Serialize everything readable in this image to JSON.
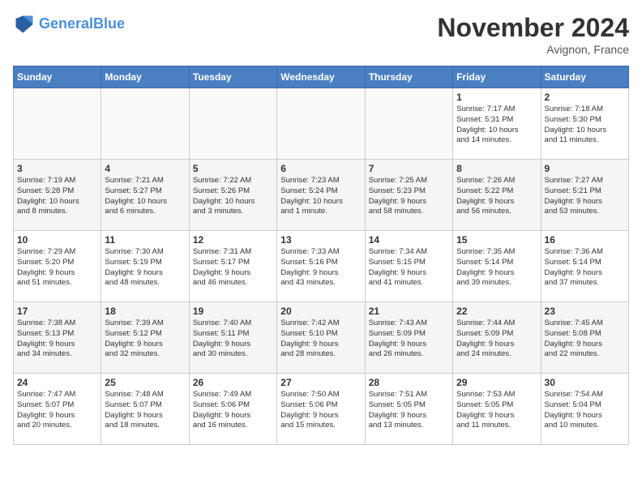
{
  "header": {
    "logo_line1": "General",
    "logo_line2": "Blue",
    "month": "November 2024",
    "location": "Avignon, France"
  },
  "weekdays": [
    "Sunday",
    "Monday",
    "Tuesday",
    "Wednesday",
    "Thursday",
    "Friday",
    "Saturday"
  ],
  "weeks": [
    [
      {
        "day": "",
        "info": ""
      },
      {
        "day": "",
        "info": ""
      },
      {
        "day": "",
        "info": ""
      },
      {
        "day": "",
        "info": ""
      },
      {
        "day": "",
        "info": ""
      },
      {
        "day": "1",
        "info": "Sunrise: 7:17 AM\nSunset: 5:31 PM\nDaylight: 10 hours\nand 14 minutes."
      },
      {
        "day": "2",
        "info": "Sunrise: 7:18 AM\nSunset: 5:30 PM\nDaylight: 10 hours\nand 11 minutes."
      }
    ],
    [
      {
        "day": "3",
        "info": "Sunrise: 7:19 AM\nSunset: 5:28 PM\nDaylight: 10 hours\nand 8 minutes."
      },
      {
        "day": "4",
        "info": "Sunrise: 7:21 AM\nSunset: 5:27 PM\nDaylight: 10 hours\nand 6 minutes."
      },
      {
        "day": "5",
        "info": "Sunrise: 7:22 AM\nSunset: 5:26 PM\nDaylight: 10 hours\nand 3 minutes."
      },
      {
        "day": "6",
        "info": "Sunrise: 7:23 AM\nSunset: 5:24 PM\nDaylight: 10 hours\nand 1 minute."
      },
      {
        "day": "7",
        "info": "Sunrise: 7:25 AM\nSunset: 5:23 PM\nDaylight: 9 hours\nand 58 minutes."
      },
      {
        "day": "8",
        "info": "Sunrise: 7:26 AM\nSunset: 5:22 PM\nDaylight: 9 hours\nand 56 minutes."
      },
      {
        "day": "9",
        "info": "Sunrise: 7:27 AM\nSunset: 5:21 PM\nDaylight: 9 hours\nand 53 minutes."
      }
    ],
    [
      {
        "day": "10",
        "info": "Sunrise: 7:29 AM\nSunset: 5:20 PM\nDaylight: 9 hours\nand 51 minutes."
      },
      {
        "day": "11",
        "info": "Sunrise: 7:30 AM\nSunset: 5:19 PM\nDaylight: 9 hours\nand 48 minutes."
      },
      {
        "day": "12",
        "info": "Sunrise: 7:31 AM\nSunset: 5:17 PM\nDaylight: 9 hours\nand 46 minutes."
      },
      {
        "day": "13",
        "info": "Sunrise: 7:33 AM\nSunset: 5:16 PM\nDaylight: 9 hours\nand 43 minutes."
      },
      {
        "day": "14",
        "info": "Sunrise: 7:34 AM\nSunset: 5:15 PM\nDaylight: 9 hours\nand 41 minutes."
      },
      {
        "day": "15",
        "info": "Sunrise: 7:35 AM\nSunset: 5:14 PM\nDaylight: 9 hours\nand 39 minutes."
      },
      {
        "day": "16",
        "info": "Sunrise: 7:36 AM\nSunset: 5:14 PM\nDaylight: 9 hours\nand 37 minutes."
      }
    ],
    [
      {
        "day": "17",
        "info": "Sunrise: 7:38 AM\nSunset: 5:13 PM\nDaylight: 9 hours\nand 34 minutes."
      },
      {
        "day": "18",
        "info": "Sunrise: 7:39 AM\nSunset: 5:12 PM\nDaylight: 9 hours\nand 32 minutes."
      },
      {
        "day": "19",
        "info": "Sunrise: 7:40 AM\nSunset: 5:11 PM\nDaylight: 9 hours\nand 30 minutes."
      },
      {
        "day": "20",
        "info": "Sunrise: 7:42 AM\nSunset: 5:10 PM\nDaylight: 9 hours\nand 28 minutes."
      },
      {
        "day": "21",
        "info": "Sunrise: 7:43 AM\nSunset: 5:09 PM\nDaylight: 9 hours\nand 26 minutes."
      },
      {
        "day": "22",
        "info": "Sunrise: 7:44 AM\nSunset: 5:09 PM\nDaylight: 9 hours\nand 24 minutes."
      },
      {
        "day": "23",
        "info": "Sunrise: 7:45 AM\nSunset: 5:08 PM\nDaylight: 9 hours\nand 22 minutes."
      }
    ],
    [
      {
        "day": "24",
        "info": "Sunrise: 7:47 AM\nSunset: 5:07 PM\nDaylight: 9 hours\nand 20 minutes."
      },
      {
        "day": "25",
        "info": "Sunrise: 7:48 AM\nSunset: 5:07 PM\nDaylight: 9 hours\nand 18 minutes."
      },
      {
        "day": "26",
        "info": "Sunrise: 7:49 AM\nSunset: 5:06 PM\nDaylight: 9 hours\nand 16 minutes."
      },
      {
        "day": "27",
        "info": "Sunrise: 7:50 AM\nSunset: 5:06 PM\nDaylight: 9 hours\nand 15 minutes."
      },
      {
        "day": "28",
        "info": "Sunrise: 7:51 AM\nSunset: 5:05 PM\nDaylight: 9 hours\nand 13 minutes."
      },
      {
        "day": "29",
        "info": "Sunrise: 7:53 AM\nSunset: 5:05 PM\nDaylight: 9 hours\nand 11 minutes."
      },
      {
        "day": "30",
        "info": "Sunrise: 7:54 AM\nSunset: 5:04 PM\nDaylight: 9 hours\nand 10 minutes."
      }
    ]
  ]
}
